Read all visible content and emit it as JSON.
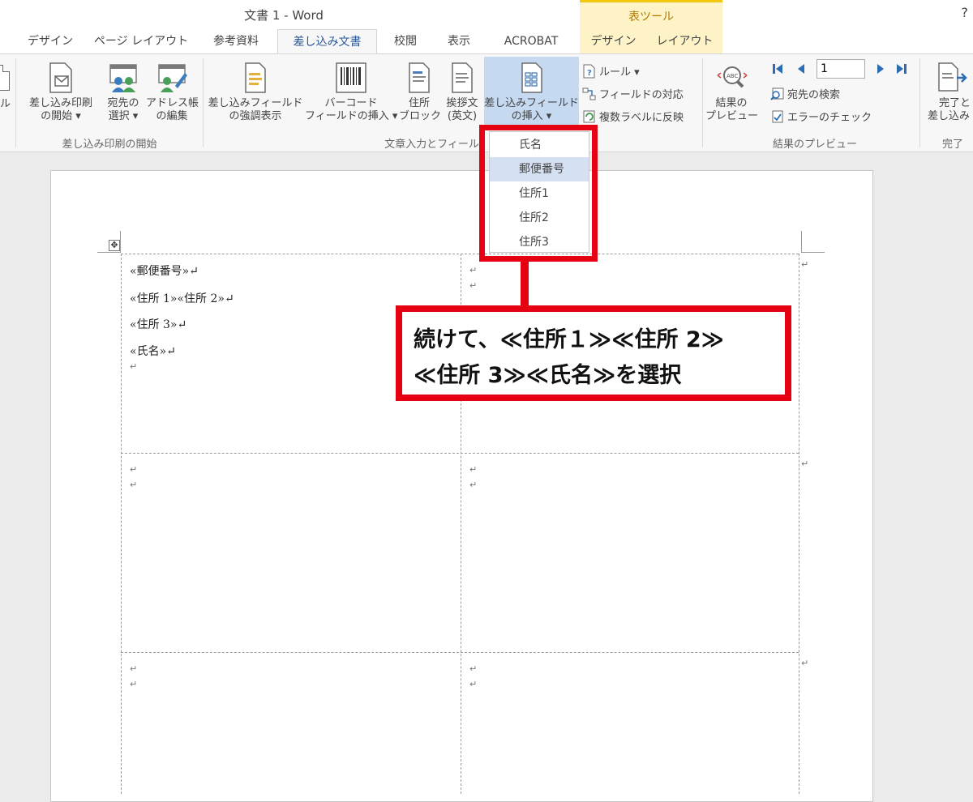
{
  "window": {
    "title": "文書 1 - Word",
    "help": "?",
    "context_tab_group": "表ツール"
  },
  "tabs": [
    {
      "label": "デザイン"
    },
    {
      "label": "ページ レイアウト"
    },
    {
      "label": "参考資料"
    },
    {
      "label": "差し込み文書"
    },
    {
      "label": "校閲"
    },
    {
      "label": "表示"
    },
    {
      "label": "ACROBAT"
    },
    {
      "label": "デザイン"
    },
    {
      "label": "レイアウト"
    }
  ],
  "ribbon": {
    "partial_left": "ル",
    "start_group": {
      "label": "差し込み印刷の開始",
      "start_merge": [
        "差し込み印刷",
        "の開始 ▾"
      ],
      "select_recipients": [
        "宛先の",
        "選択 ▾"
      ],
      "edit_recipients": [
        "アドレス帳",
        "の編集"
      ]
    },
    "write_group": {
      "label": "文章入力とフィール",
      "highlight_fields": [
        "差し込みフィールド",
        "の強調表示"
      ],
      "barcode": [
        "バーコード",
        "フィールドの挿入 ▾"
      ],
      "address_block": [
        "住所",
        "ブロック"
      ],
      "greeting": [
        "挨拶文",
        "(英文)"
      ],
      "insert_field": [
        "差し込みフィールド",
        "の挿入 ▾"
      ],
      "rules": "ルール ▾",
      "match_fields": "フィールドの対応",
      "update_labels": "複数ラベルに反映"
    },
    "preview_group": {
      "label": "結果のプレビュー",
      "preview_results": [
        "結果の",
        "プレビュー"
      ],
      "record_number": "1",
      "find_recipient": "宛先の検索",
      "check_errors": "エラーのチェック"
    },
    "finish_group": {
      "label": "完了",
      "finish_merge": [
        "完了と",
        "差し込み"
      ]
    }
  },
  "dropdown": {
    "items": [
      "氏名",
      "郵便番号",
      "住所1",
      "住所2",
      "住所3"
    ],
    "highlighted_index": 1
  },
  "document": {
    "first_cell_lines": [
      "«郵便番号»↵",
      "«住所 1»«住所 2»↵",
      "«住所 3»↵",
      "«氏名»↵",
      "↵"
    ],
    "para_mark": "↵"
  },
  "callout": {
    "line1": "続けて、≪住所１≫≪住所 2≫",
    "line2": "≪住所 3≫≪氏名≫を選択"
  },
  "colors": {
    "annotation_red": "#e50012",
    "active_tab": "#2b579a",
    "context_yellow": "#fdf3c7"
  }
}
